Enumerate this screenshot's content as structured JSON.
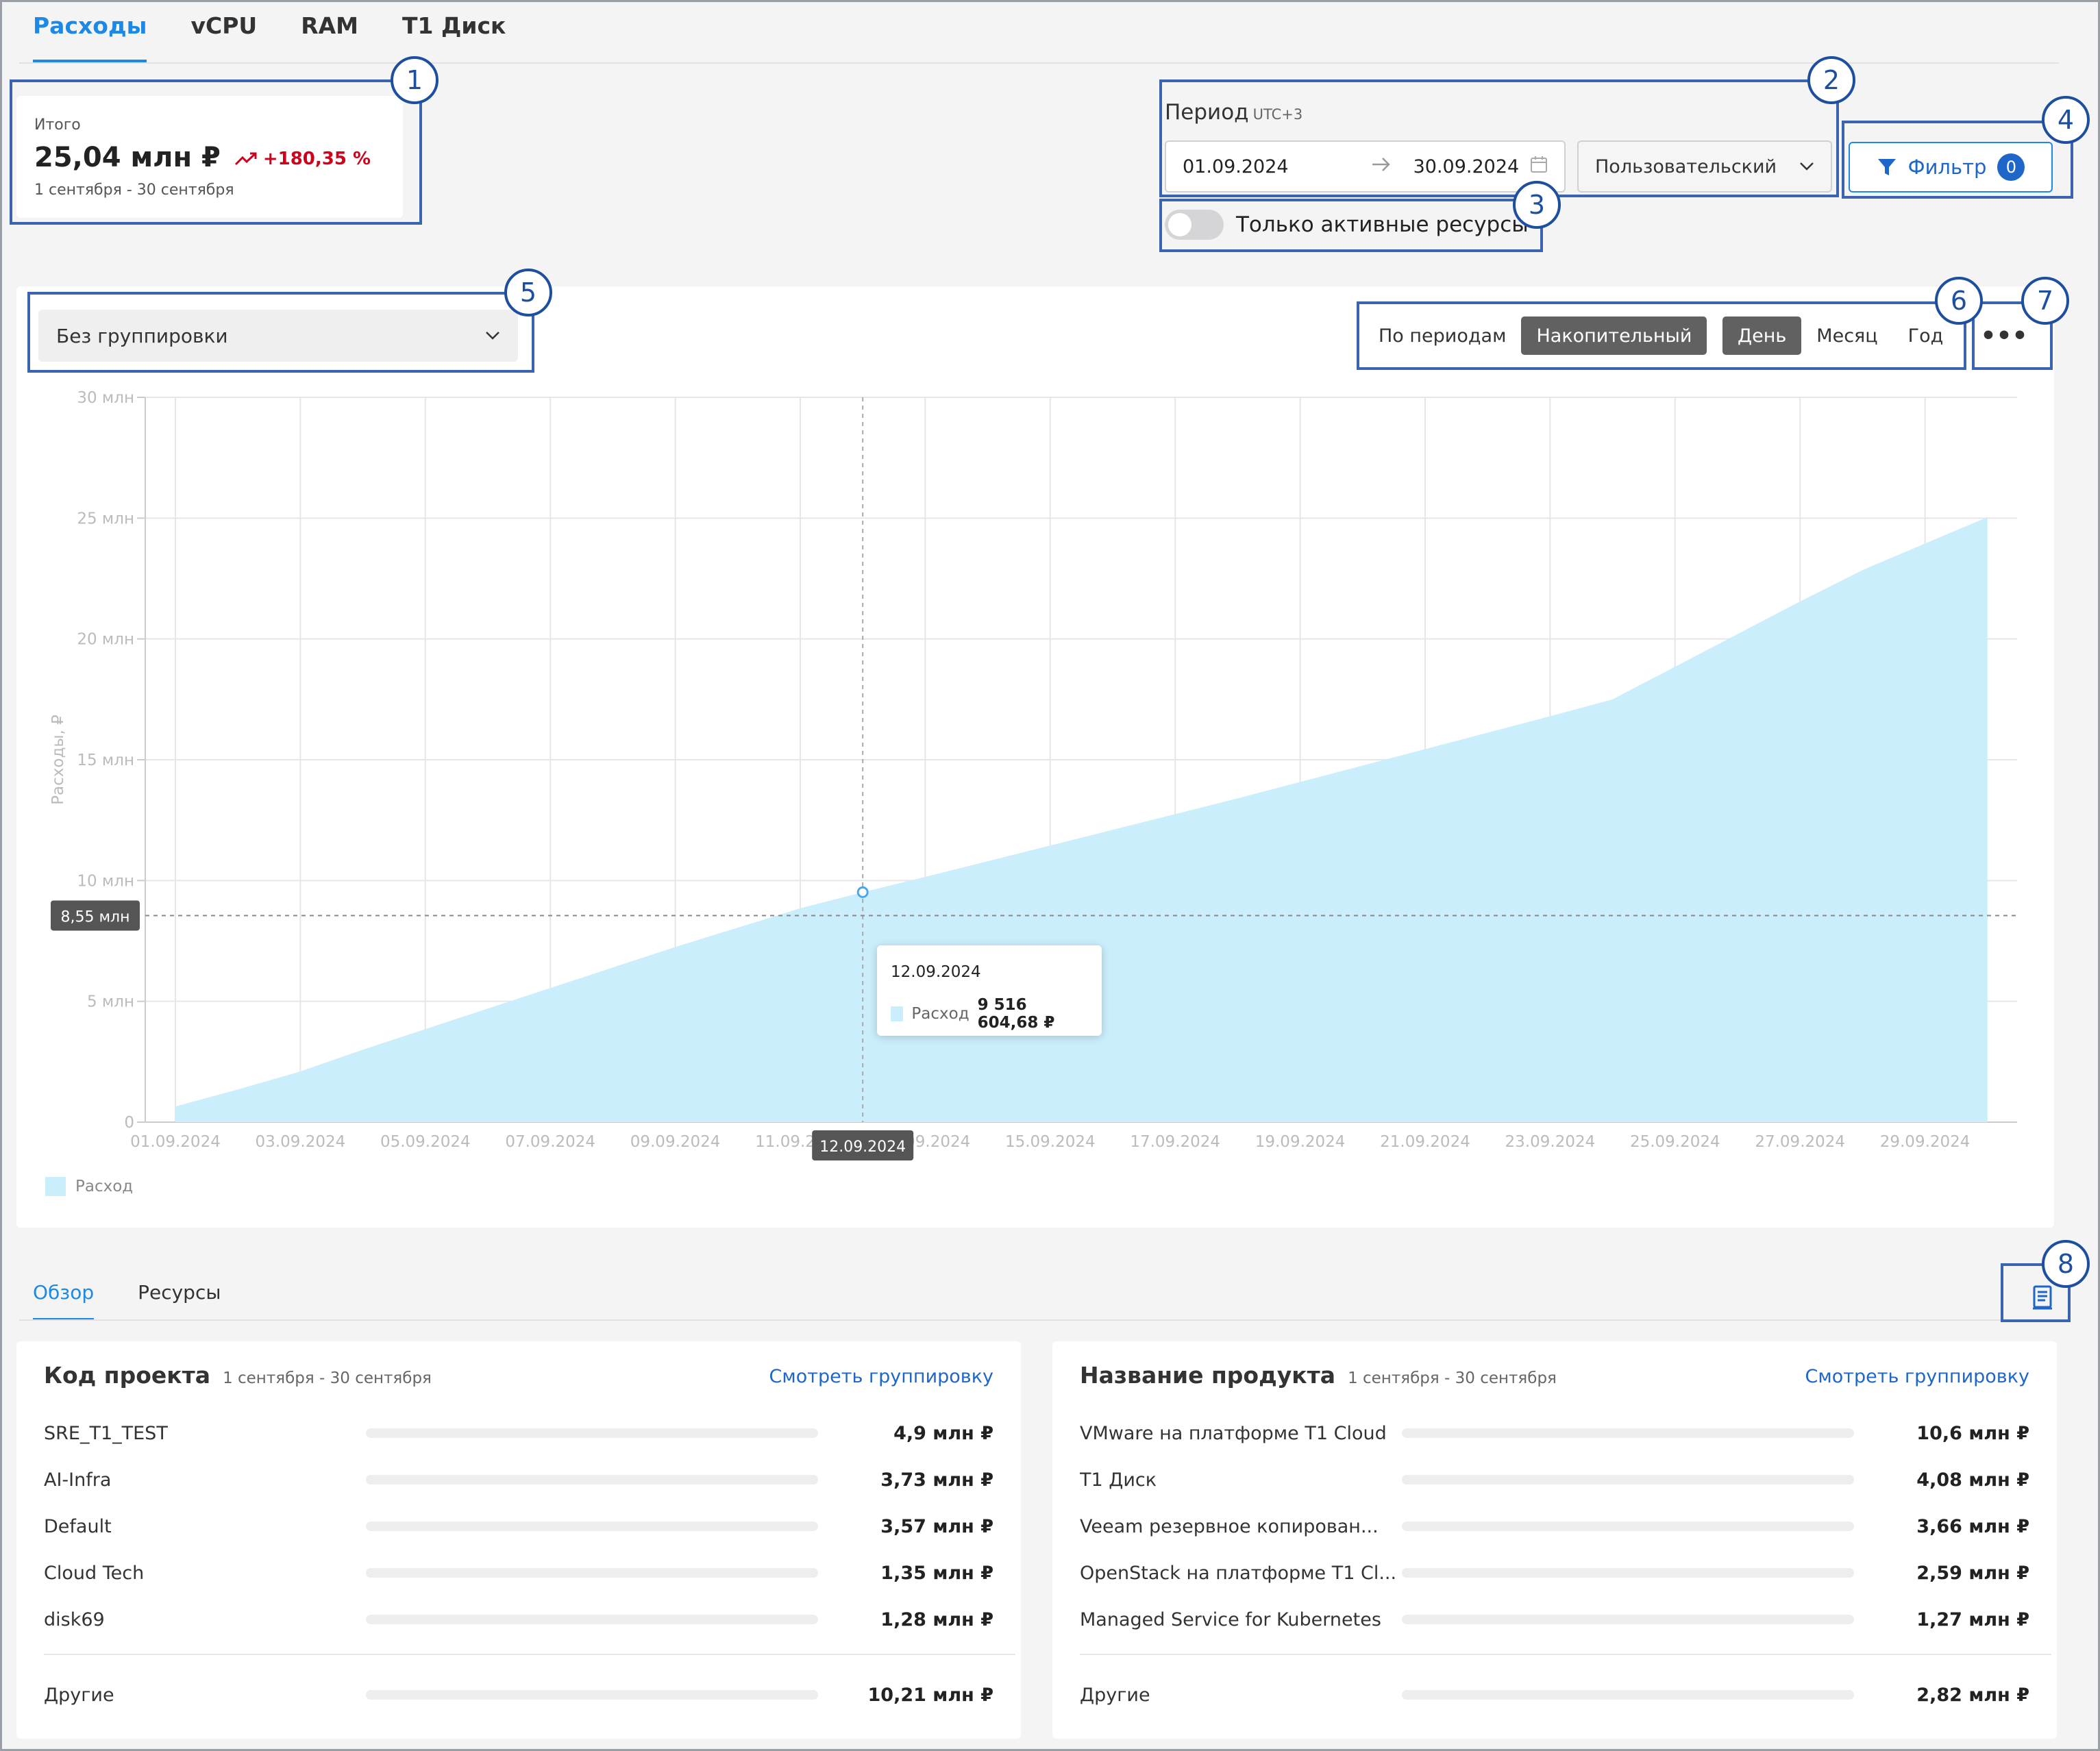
{
  "tabs": [
    "Расходы",
    "vCPU",
    "RAM",
    "Т1 Диск"
  ],
  "total": {
    "label": "Итого",
    "value": "25,04 млн ₽",
    "delta": "+180,35 %",
    "range": "1 сентября - 30 сентября"
  },
  "period": {
    "label": "Период",
    "tz": "UTC+3",
    "from": "01.09.2024",
    "to": "30.09.2024",
    "preset": "Пользовательский"
  },
  "filter": {
    "label": "Фильтр",
    "count": "0"
  },
  "active_only": "Только активные ресурсы",
  "grouping": "Без группировки",
  "mode_options": [
    "По периодам",
    "Накопительный"
  ],
  "mode_selected": "Накопительный",
  "granularity_options": [
    "День",
    "Месяц",
    "Год"
  ],
  "granularity_selected": "День",
  "more": "•••",
  "callouts": [
    "1",
    "2",
    "3",
    "4",
    "5",
    "6",
    "7",
    "8"
  ],
  "chart_data": {
    "type": "area",
    "ylabel": "Расходы, ₽",
    "ylim": [
      0,
      30000000
    ],
    "yticks": [
      "0",
      "5 млн",
      "10 млн",
      "15 млн",
      "20 млн",
      "25 млн",
      "30 млн"
    ],
    "ytick_values": [
      0,
      5000000,
      10000000,
      15000000,
      20000000,
      25000000,
      30000000
    ],
    "xticks": [
      "01.09.2024",
      "03.09.2024",
      "05.09.2024",
      "07.09.2024",
      "09.09.2024",
      "11.09.2024",
      "13.09.2024",
      "15.09.2024",
      "17.09.2024",
      "19.09.2024",
      "21.09.2024",
      "23.09.2024",
      "25.09.2024",
      "27.09.2024",
      "29.09.2024"
    ],
    "grid": true,
    "legend": "bottom-left",
    "color": "#cbeefc",
    "series": [
      {
        "name": "Расход",
        "x": [
          "01.09.2024",
          "02.09.2024",
          "03.09.2024",
          "04.09.2024",
          "05.09.2024",
          "06.09.2024",
          "07.09.2024",
          "08.09.2024",
          "09.09.2024",
          "10.09.2024",
          "11.09.2024",
          "12.09.2024",
          "13.09.2024",
          "14.09.2024",
          "15.09.2024",
          "16.09.2024",
          "17.09.2024",
          "18.09.2024",
          "19.09.2024",
          "20.09.2024",
          "21.09.2024",
          "22.09.2024",
          "23.09.2024",
          "24.09.2024",
          "25.09.2024",
          "26.09.2024",
          "27.09.2024",
          "28.09.2024",
          "29.09.2024",
          "30.09.2024"
        ],
        "values": [
          650000,
          1350000,
          2100000,
          3000000,
          3850000,
          4700000,
          5550000,
          6400000,
          7250000,
          8050000,
          8850000,
          9516604.68,
          10150000,
          10800000,
          11450000,
          12100000,
          12750000,
          13400000,
          14080000,
          14760000,
          15440000,
          16120000,
          16800000,
          17500000,
          18850000,
          20200000,
          21550000,
          22850000,
          23950000,
          25040000
        ]
      }
    ],
    "crosshair": {
      "x_label": "12.09.2024",
      "y_label": "8,55 млн"
    },
    "tooltip": {
      "date": "12.09.2024",
      "series": "Расход",
      "value": "9 516 604,68 ₽"
    }
  },
  "sub_tabs": [
    "Обзор",
    "Ресурсы"
  ],
  "panels": [
    {
      "title": "Код проекта",
      "range": "1 сентября - 30 сентября",
      "link": "Смотреть группировку",
      "rows": [
        {
          "name": "SRE_T1_TEST",
          "value": "4,9 млн ₽"
        },
        {
          "name": "AI-Infra",
          "value": "3,73 млн ₽"
        },
        {
          "name": "Default",
          "value": "3,57 млн ₽"
        },
        {
          "name": "Cloud Tech",
          "value": "1,35 млн ₽"
        },
        {
          "name": "disk69",
          "value": "1,28 млн ₽"
        }
      ],
      "other": {
        "name": "Другие",
        "value": "10,21 млн ₽"
      }
    },
    {
      "title": "Название продукта",
      "range": "1 сентября - 30 сентября",
      "link": "Смотреть группировку",
      "rows": [
        {
          "name": "VMware на платформе T1 Cloud",
          "value": "10,6 млн ₽"
        },
        {
          "name": "Т1 Диск",
          "value": "4,08 млн ₽"
        },
        {
          "name": "Veeam резервное копирован...",
          "value": "3,66 млн ₽"
        },
        {
          "name": "OpenStack на платформе T1 Cl...",
          "value": "2,59 млн ₽"
        },
        {
          "name": "Managed Service for Kubernetes",
          "value": "1,27 млн ₽"
        }
      ],
      "other": {
        "name": "Другие",
        "value": "2,82 млн ₽"
      }
    }
  ]
}
